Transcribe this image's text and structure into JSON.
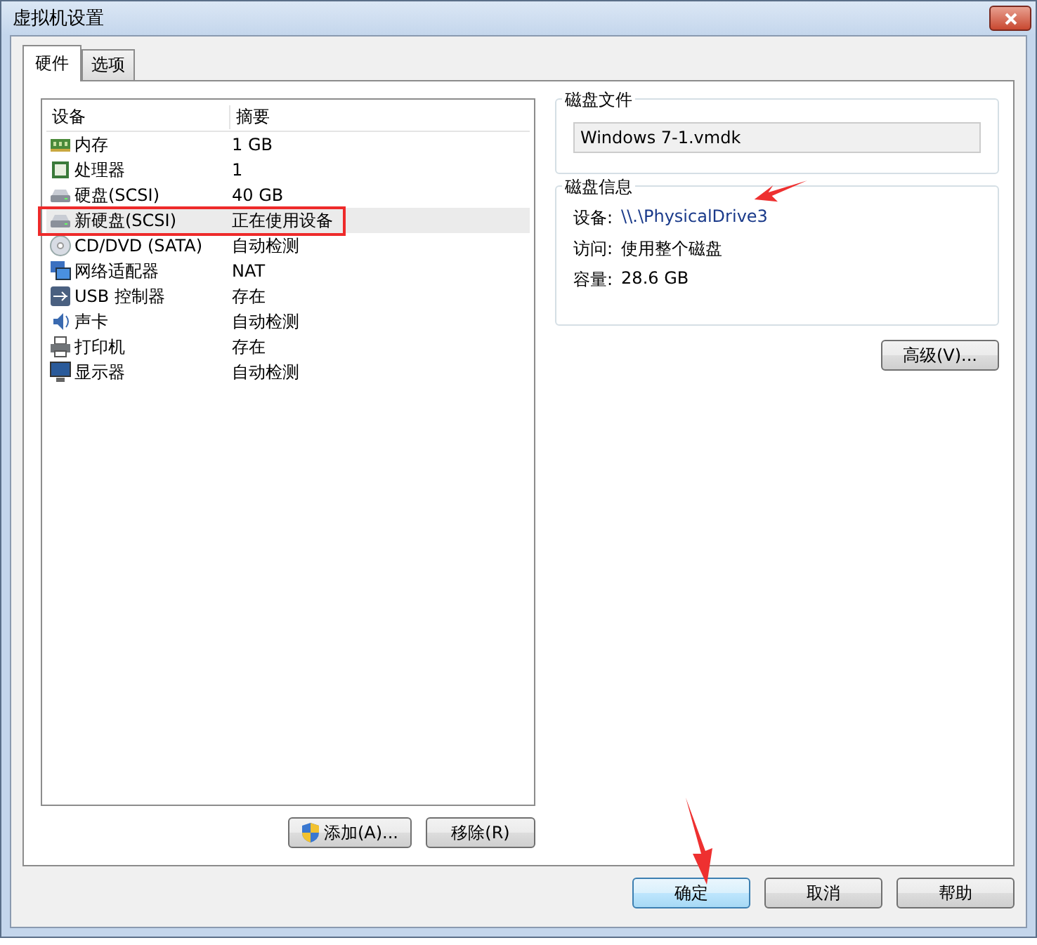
{
  "window": {
    "title": "虚拟机设置"
  },
  "tabs": [
    {
      "label": "硬件",
      "selected": true
    },
    {
      "label": "选项",
      "selected": false
    }
  ],
  "device_list": {
    "columns": [
      "设备",
      "摘要"
    ],
    "rows": [
      {
        "kind": "memory",
        "device": "内存",
        "summary": "1 GB",
        "selected": false
      },
      {
        "kind": "cpu",
        "device": "处理器",
        "summary": "1",
        "selected": false
      },
      {
        "kind": "disk",
        "device": "硬盘(SCSI)",
        "summary": "40 GB",
        "selected": false
      },
      {
        "kind": "disk",
        "device": "新硬盘(SCSI)",
        "summary": "正在使用设备",
        "selected": true
      },
      {
        "kind": "cdrom",
        "device": "CD/DVD (SATA)",
        "summary": "自动检测",
        "selected": false
      },
      {
        "kind": "network",
        "device": "网络适配器",
        "summary": "NAT",
        "selected": false
      },
      {
        "kind": "usb",
        "device": "USB 控制器",
        "summary": "存在",
        "selected": false
      },
      {
        "kind": "sound",
        "device": "声卡",
        "summary": "自动检测",
        "selected": false
      },
      {
        "kind": "printer",
        "device": "打印机",
        "summary": "存在",
        "selected": false
      },
      {
        "kind": "display",
        "device": "显示器",
        "summary": "自动检测",
        "selected": false
      }
    ]
  },
  "list_buttons": [
    {
      "label": "添加(A)...",
      "shield": true
    },
    {
      "label": "移除(R)",
      "shield": false
    }
  ],
  "disk_file": {
    "title": "磁盘文件",
    "value": "Windows 7-1.vmdk"
  },
  "disk_info": {
    "title": "磁盘信息",
    "lines": [
      {
        "label": "设备:",
        "value": "\\\\.\\PhysicalDrive3"
      },
      {
        "label": "访问:",
        "value": "使用整个磁盘"
      },
      {
        "label": "容量:",
        "value": "28.6 GB"
      }
    ]
  },
  "advanced_button": "高级(V)...",
  "dialog_buttons": [
    {
      "label": "确定",
      "default": true
    },
    {
      "label": "取消",
      "default": false
    },
    {
      "label": "帮助",
      "default": false
    }
  ]
}
